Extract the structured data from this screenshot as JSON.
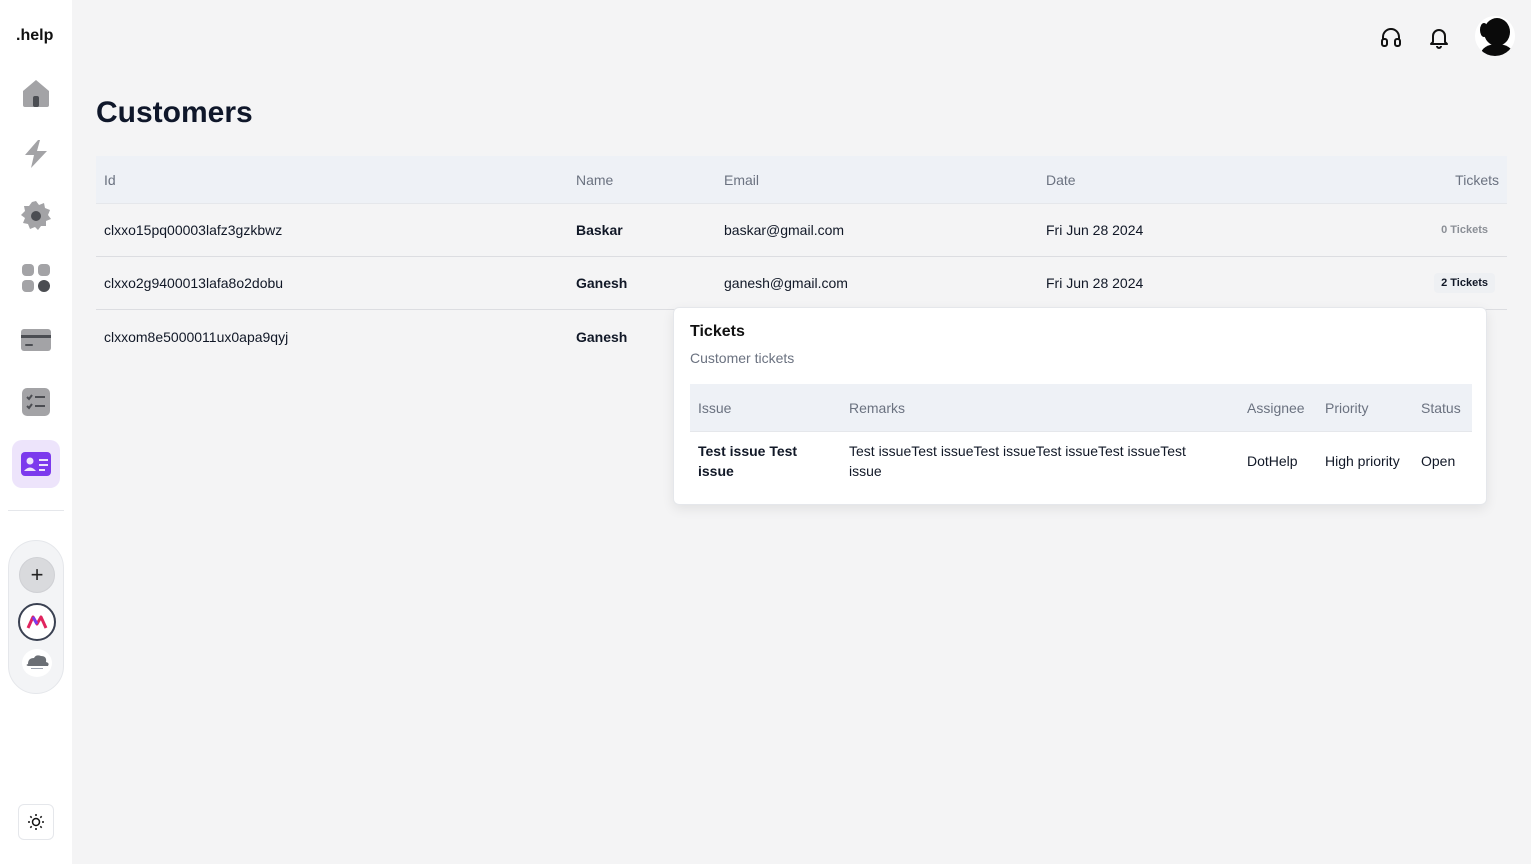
{
  "brand": ".help",
  "sidebar": {
    "items": [
      {
        "name": "home",
        "icon": "home-icon"
      },
      {
        "name": "automation",
        "icon": "bolt-icon"
      },
      {
        "name": "settings",
        "icon": "gear-icon"
      },
      {
        "name": "apps",
        "icon": "grid-icon"
      },
      {
        "name": "billing",
        "icon": "card-icon"
      },
      {
        "name": "tasks",
        "icon": "checklist-icon"
      },
      {
        "name": "customers",
        "icon": "contact-card-icon",
        "active": true
      }
    ],
    "add_label": "+",
    "active_color": "#7c3aed"
  },
  "page": {
    "title": "Customers"
  },
  "table": {
    "headers": {
      "id": "Id",
      "name": "Name",
      "email": "Email",
      "date": "Date",
      "tickets": "Tickets"
    },
    "rows": [
      {
        "id": "clxxo15pq00003lafz3gzkbwz",
        "name": "Baskar",
        "email": "baskar@gmail.com",
        "date": "Fri Jun 28 2024",
        "tickets": "0 Tickets"
      },
      {
        "id": "clxxo2g9400013lafa8o2dobu",
        "name": "Ganesh",
        "email": "ganesh@gmail.com",
        "date": "Fri Jun 28 2024",
        "tickets": "2 Tickets"
      },
      {
        "id": "clxxom8e5000011ux0apa9qyj",
        "name": "Ganesh",
        "email": "",
        "date": "",
        "tickets": ""
      }
    ]
  },
  "popover": {
    "title": "Tickets",
    "subtitle": "Customer tickets",
    "headers": {
      "issue": "Issue",
      "remarks": "Remarks",
      "assignee": "Assignee",
      "priority": "Priority",
      "status": "Status"
    },
    "rows": [
      {
        "issue": "Test issue Test issue",
        "remarks": "Test issueTest issueTest issueTest issueTest issueTest issue",
        "assignee": "DotHelp",
        "priority": "High priority",
        "status": "Open"
      }
    ]
  }
}
